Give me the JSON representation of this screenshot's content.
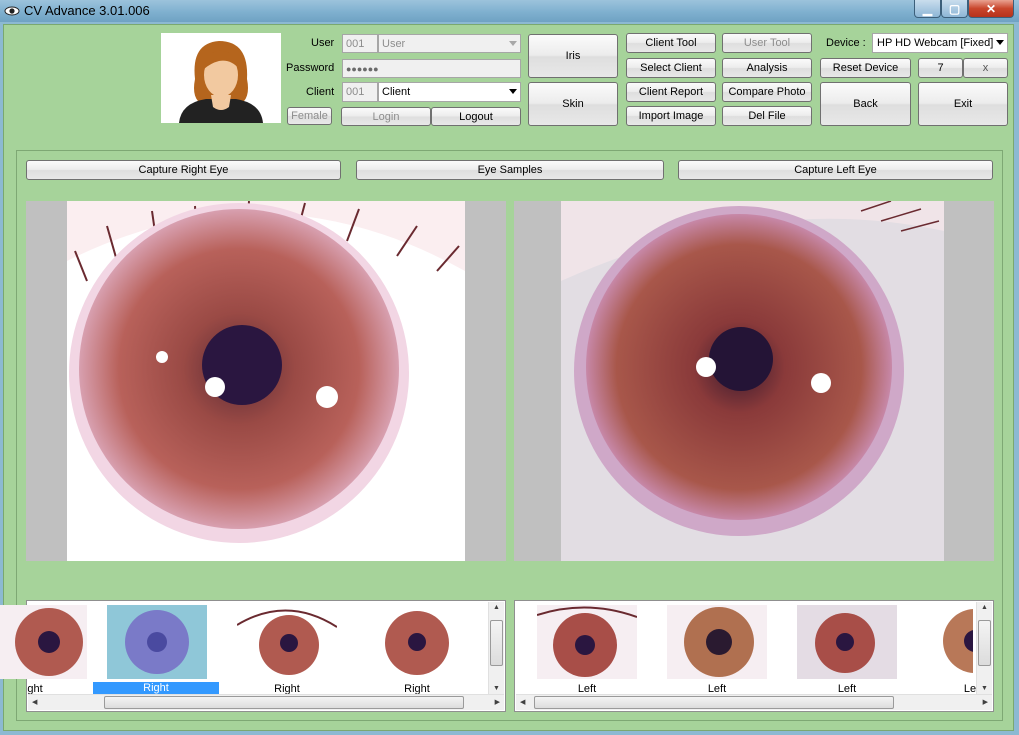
{
  "window": {
    "title": "CV Advance 3.01.006"
  },
  "login": {
    "user_label": "User",
    "user_id": "001",
    "user_value": "User",
    "password_label": "Password",
    "password_value": "●●●●●●",
    "client_label": "Client",
    "client_id": "001",
    "client_value": "Client",
    "gender": "Female",
    "login_label": "Login",
    "logout_label": "Logout"
  },
  "modes": {
    "iris": "Iris",
    "skin": "Skin"
  },
  "tools": {
    "client_tool": "Client Tool",
    "select_client": "Select Client",
    "client_report": "Client Report",
    "import_image": "Import Image",
    "user_tool": "User Tool",
    "analysis": "Analysis",
    "compare_photo": "Compare Photo",
    "del_file": "Del File"
  },
  "device": {
    "label": "Device :",
    "selected": "HP HD Webcam [Fixed]",
    "reset_label": "Reset Device",
    "count": "7",
    "clear_label": "x"
  },
  "nav": {
    "back": "Back",
    "exit": "Exit"
  },
  "capture": {
    "right_label": "Capture Right Eye",
    "samples_label": "Eye Samples",
    "left_label": "Capture Left Eye"
  },
  "gallery": {
    "right": [
      "ght",
      "Right",
      "Right",
      "Right"
    ],
    "left": [
      "Left",
      "Left",
      "Left",
      "Le"
    ]
  },
  "colors": {
    "panel": "#a6d39a",
    "selection": "#3399ff",
    "iris": "#a8574a"
  }
}
